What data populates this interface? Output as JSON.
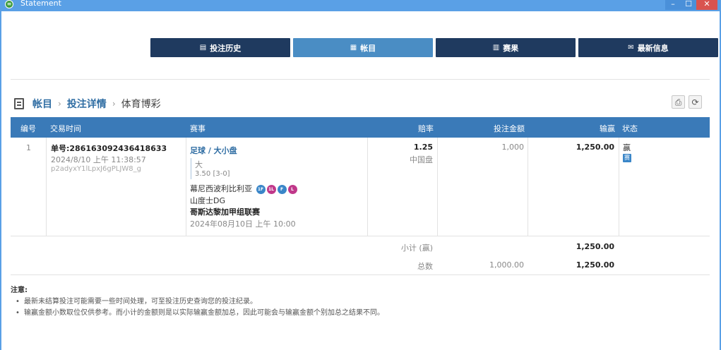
{
  "window": {
    "title": "Statement",
    "controls": [
      "–",
      "☐",
      "✕"
    ]
  },
  "nav": [
    {
      "label": "投注历史",
      "icon": "receipt-icon",
      "active": false
    },
    {
      "label": "帐目",
      "icon": "ledger-icon",
      "active": true
    },
    {
      "label": "赛果",
      "icon": "trophy-icon",
      "active": false
    },
    {
      "label": "最新信息",
      "icon": "mail-icon",
      "active": false
    }
  ],
  "breadcrumb": {
    "items": [
      "帐目",
      "投注详情",
      "体育博彩"
    ]
  },
  "table": {
    "headers": {
      "no": "编号",
      "time": "交易时间",
      "event": "赛事",
      "odds": "赔率",
      "stake": "投注金额",
      "winloss": "输赢",
      "status": "状态"
    },
    "row": {
      "no": "1",
      "ticket": "单号:286163092436418633",
      "datetime": "2024/8/10 上午 11:38:57",
      "code": "p2adyxY1lLpxJ6gPLJW8_g",
      "bet_type": "足球 / 大小盘",
      "selection": "大",
      "line": "3.50 [3-0]",
      "team_home": "幕尼西波利比利亚",
      "badges": [
        "1F",
        "1L",
        "F",
        "L"
      ],
      "team_away": "山度士DG",
      "league": "哥斯达黎加甲组联赛",
      "match_time": "2024年08月10日 上午 10:00",
      "odds": "1.25",
      "odds_type": "中国盘",
      "stake": "1,000",
      "winloss": "1,250.00",
      "status": "赢",
      "status_chip": "赛"
    },
    "subtotal": {
      "label": "小计 (赢)",
      "winloss": "1,250.00"
    },
    "total": {
      "label": "总数",
      "stake": "1,000.00",
      "winloss": "1,250.00"
    }
  },
  "notes": {
    "title": "注意:",
    "items": [
      "最新未结算投注可能需要一些时间处理，可至投注历史查询您的投注纪录。",
      "输赢金额小数取位仅供参考。而小计的金额则是以实际输赢金额加总，因此可能会与输赢金额个别加总之结果不同。"
    ]
  },
  "colors": {
    "titlebar": "#5aa0e6",
    "nav_dark": "#1f3a5f",
    "nav_active": "#4a8dc4",
    "table_header": "#3a7ab8",
    "link": "#2f6da3"
  }
}
